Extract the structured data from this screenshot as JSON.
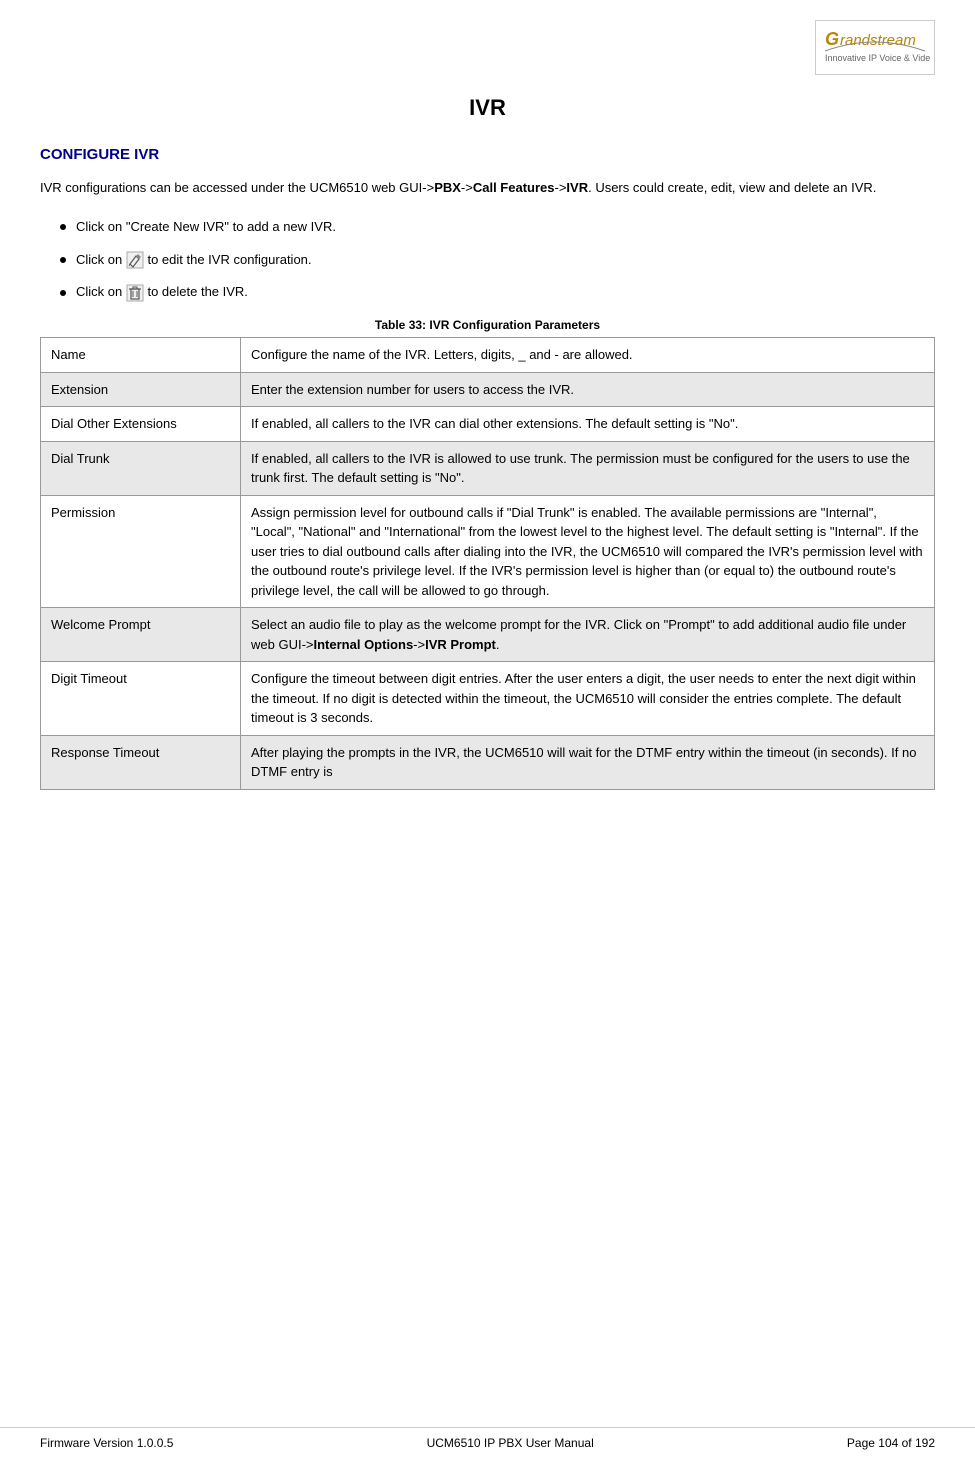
{
  "header": {
    "logo_text": "randstream",
    "logo_prefix": "G",
    "logo_sub": "Innovative IP Voice & Video"
  },
  "page": {
    "title": "IVR",
    "section_heading": "CONFIGURE IVR",
    "intro": "IVR configurations can be accessed under the UCM6510 web GUI->PBX->Call Features->IVR. Users could create, edit, view and delete an IVR.",
    "bullets": [
      {
        "id": "b1",
        "text": "Click on \"Create New IVR\" to add a new IVR."
      },
      {
        "id": "b2",
        "text_before": "Click on ",
        "icon": "pencil",
        "text_after": " to edit the IVR configuration."
      },
      {
        "id": "b3",
        "text_before": "Click on ",
        "icon": "trash",
        "text_after": " to delete the IVR."
      }
    ]
  },
  "table": {
    "title": "Table 33: IVR Configuration Parameters",
    "rows": [
      {
        "label": "Name",
        "value": "Configure the name of the IVR. Letters, digits, _ and - are allowed.",
        "shaded": false
      },
      {
        "label": "Extension",
        "value": "Enter the extension number for users to access the IVR.",
        "shaded": true
      },
      {
        "label": "Dial Other Extensions",
        "value": "If enabled, all callers to the IVR can dial other extensions. The default setting is \"No\".",
        "shaded": false
      },
      {
        "label": "Dial Trunk",
        "value": "If enabled, all callers to the IVR is allowed to use trunk. The permission must be configured for the users to use the trunk first. The default setting is \"No\".",
        "shaded": true
      },
      {
        "label": "Permission",
        "value": "Assign permission level for outbound calls if \"Dial Trunk\" is enabled. The available permissions are \"Internal\", \"Local\", \"National\" and \"International\" from the lowest level to the highest level. The default setting is \"Internal\". If the user tries to dial outbound calls after dialing into the IVR, the UCM6510 will compared the IVR's permission level with the outbound route's privilege level. If the IVR's permission level is higher than (or equal to) the outbound route's privilege level, the call will be allowed to go through.",
        "shaded": false
      },
      {
        "label": "Welcome Prompt",
        "value": "Select an audio file to play as the welcome prompt for the IVR. Click on \"Prompt\" to add additional audio file under web GUI->Internal Options->IVR Prompt.",
        "shaded": true,
        "bold_parts": [
          "Internal Options->IVR Prompt",
          "Internal\nOptions->IVR Prompt"
        ]
      },
      {
        "label": "Digit Timeout",
        "value": "Configure the timeout between digit entries. After the user enters a digit, the user needs to enter the next digit within the timeout. If no digit is detected within the timeout, the UCM6510 will consider the entries complete. The default timeout is 3 seconds.",
        "shaded": false
      },
      {
        "label": "Response Timeout",
        "value": "After playing the prompts in the IVR, the UCM6510 will wait for the DTMF entry within the timeout (in seconds). If no DTMF entry is",
        "shaded": true
      }
    ]
  },
  "footer": {
    "firmware": "Firmware Version 1.0.0.5",
    "manual": "UCM6510 IP PBX User Manual",
    "page": "Page 104 of 192"
  }
}
